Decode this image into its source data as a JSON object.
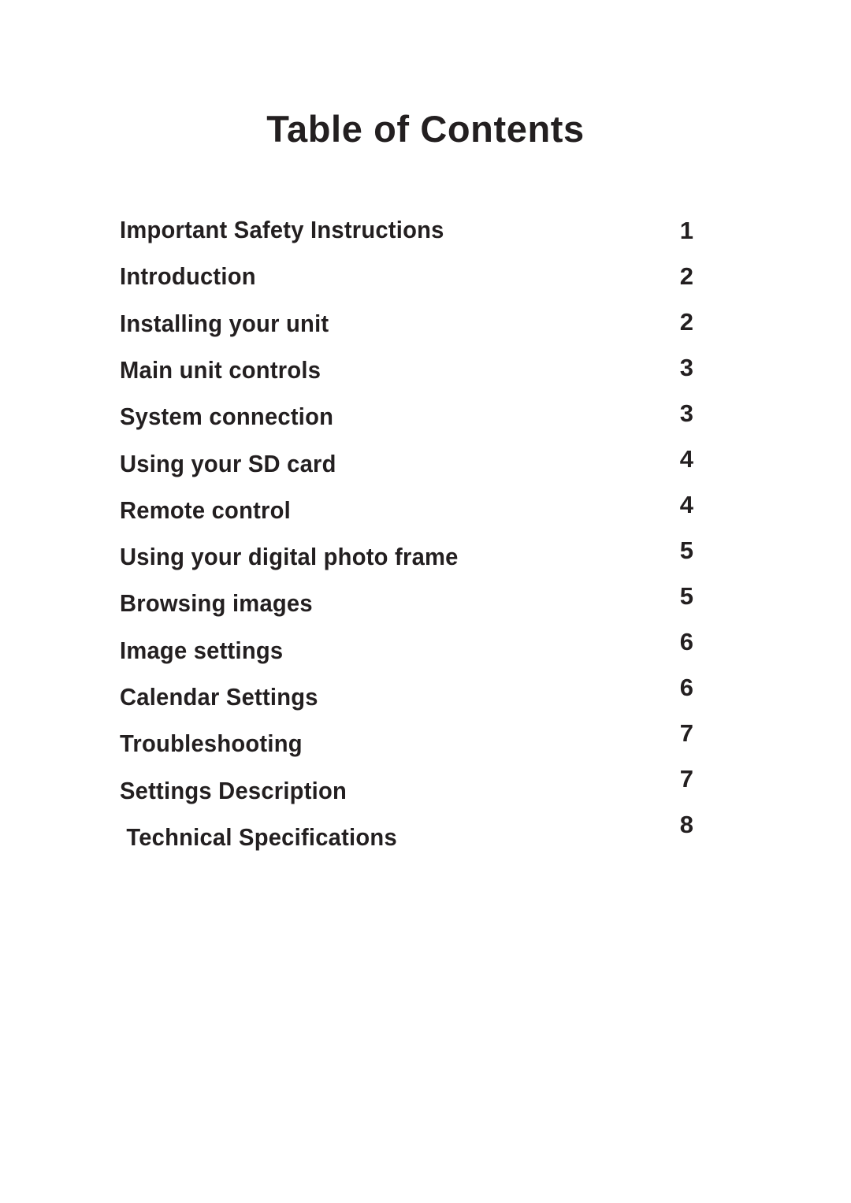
{
  "document": {
    "title": "Table of Contents",
    "text_color": "#231f20",
    "background_color": "#ffffff"
  },
  "toc": {
    "entries": [
      {
        "label": "Important Safety Instructions",
        "page": "1"
      },
      {
        "label": "Introduction",
        "page": "2"
      },
      {
        "label": "Installing your unit",
        "page": "2"
      },
      {
        "label": "Main unit controls",
        "page": "3"
      },
      {
        "label": "System connection",
        "page": "3"
      },
      {
        "label": "Using your SD card",
        "page": "4"
      },
      {
        "label": "Remote control",
        "page": "4"
      },
      {
        "label": "Using your digital photo frame",
        "page": "5"
      },
      {
        "label": "Browsing images",
        "page": "5"
      },
      {
        "label": "Image settings",
        "page": "6"
      },
      {
        "label": "Calendar Settings",
        "page": "6"
      },
      {
        "label": "Troubleshooting",
        "page": "7"
      },
      {
        "label": "Settings Description",
        "page": "7"
      },
      {
        "label": " Technical Specifications",
        "page": "8"
      }
    ]
  }
}
